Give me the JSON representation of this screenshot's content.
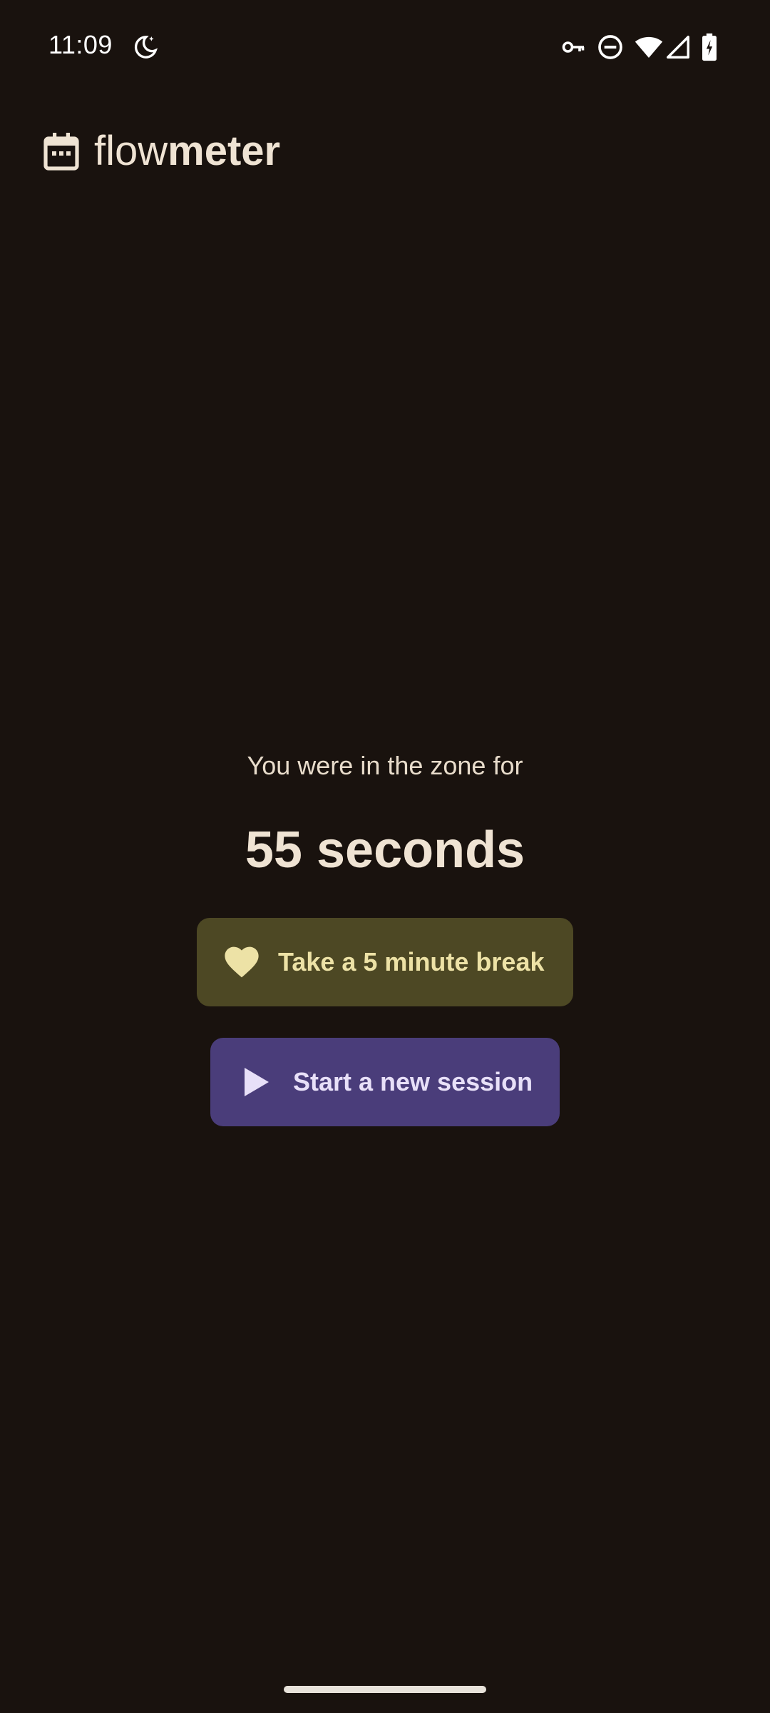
{
  "status_bar": {
    "time": "11:09",
    "icons": [
      "do-not-disturb-moon-icon",
      "vpn-key-icon",
      "dnd-minus-icon",
      "wifi-icon",
      "signal-icon",
      "battery-charging-icon"
    ]
  },
  "header": {
    "title_light": "flow",
    "title_bold": "meter",
    "logo_icon": "calendar-icon"
  },
  "main": {
    "zone_label": "You were in the zone for",
    "duration": "55 seconds",
    "break_button": {
      "label": "Take a 5 minute break",
      "icon": "heart-icon"
    },
    "session_button": {
      "label": "Start a new session",
      "icon": "play-icon"
    }
  },
  "colors": {
    "background": "#19120e",
    "text": "#efe3d3",
    "break_button_bg": "#4d4824",
    "break_button_text": "#ede2a6",
    "session_button_bg": "#4a3d7a",
    "session_button_text": "#e8e0f8"
  }
}
